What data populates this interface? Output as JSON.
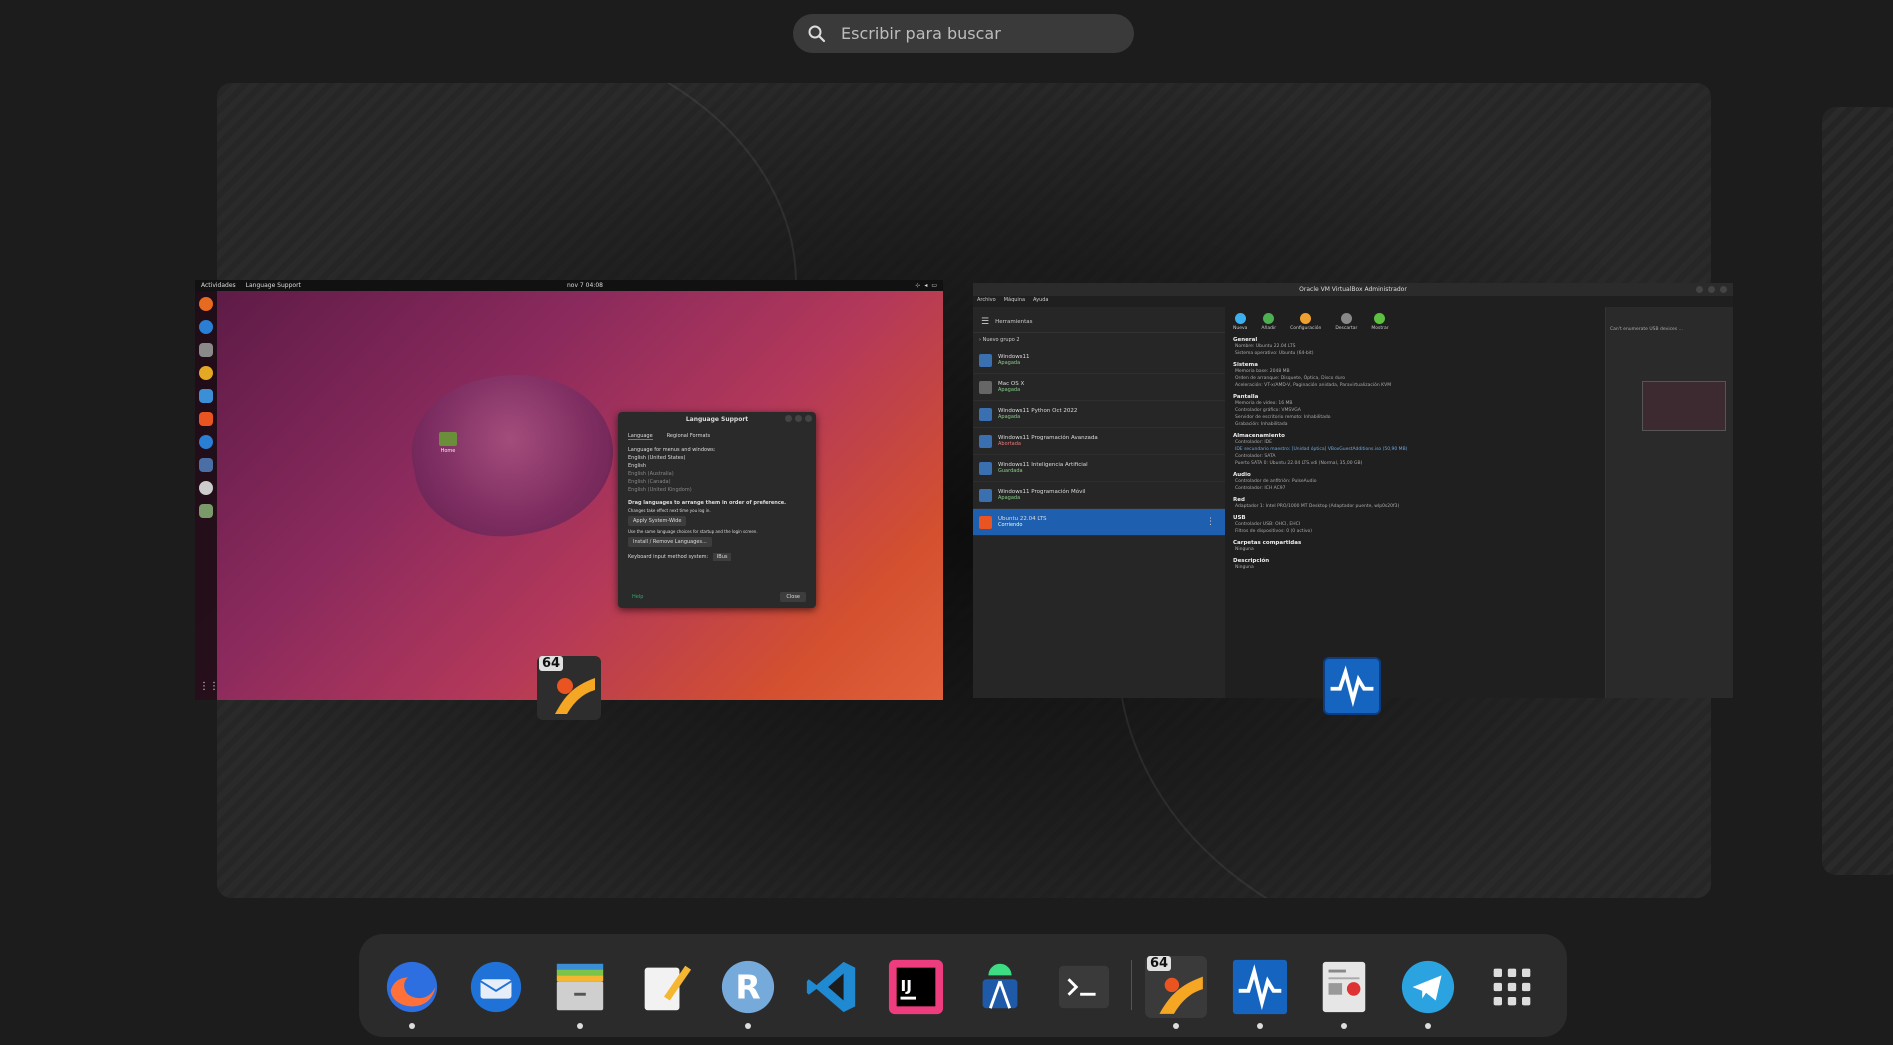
{
  "search": {
    "placeholder": "Escribir para buscar"
  },
  "ubuntu_window": {
    "topbar": {
      "activities": "Actividades",
      "app": "Language Support",
      "clock": "nov 7  04:08"
    },
    "desktop_icon_label": "Home",
    "dialog": {
      "title": "Language Support",
      "tabs": [
        "Language",
        "Regional Formats"
      ],
      "heading": "Language for menus and windows:",
      "languages": [
        "English (United States)",
        "English",
        "English (Australia)",
        "English (Canada)",
        "English (United Kingdom)"
      ],
      "drag_hint": "Drag languages to arrange them in order of preference.",
      "drag_hint_sub": "Changes take effect next time you log in.",
      "apply_button": "Apply System-Wide",
      "same_hint": "Use the same language choices for startup and the login screen.",
      "install_button": "Install / Remove Languages...",
      "keyboard_label": "Keyboard input method system:",
      "keyboard_value": "IBus",
      "help": "Help",
      "close": "Close"
    }
  },
  "vbox_window": {
    "title": "Oracle VM VirtualBox Administrador",
    "menu": [
      "Archivo",
      "Máquina",
      "Ayuda"
    ],
    "tools_label": "Herramientas",
    "group_label": "Nuevo grupo 2",
    "vms": [
      {
        "name": "Windows11",
        "state": "Apagada"
      },
      {
        "name": "Mac OS X",
        "state": "Apagada"
      },
      {
        "name": "Windows11 Python Oct 2022",
        "state": "Apagada"
      },
      {
        "name": "Windows11 Programación Avanzada",
        "state": "Abortada"
      },
      {
        "name": "Windows11 Inteligencia Artificial",
        "state": "Guardada"
      },
      {
        "name": "Windows11 Programación Móvil",
        "state": "Apagada"
      },
      {
        "name": "Ubuntu 22.04 LTS",
        "state": "Corriendo"
      }
    ],
    "toolbar": [
      "Nueva",
      "Añadir",
      "Configuración",
      "Descartar",
      "Mostrar"
    ],
    "sections": [
      {
        "title": "General",
        "rows": [
          "Nombre:  Ubuntu 22.04 LTS",
          "Sistema operativo:  Ubuntu (64-bit)"
        ]
      },
      {
        "title": "Sistema",
        "rows": [
          "Memoria base:  2048 MB",
          "Orden de arranque:  Disquete, Óptica, Disco duro",
          "Aceleración:  VT-x/AMD-V, Paginación anidada, Paravirtualización KVM"
        ]
      },
      {
        "title": "Pantalla",
        "rows": [
          "Memoria de vídeo:  16 MB",
          "Controlador gráfico:  VMSVGA",
          "Servidor de escritorio remoto:  Inhabilitado",
          "Grabación:  Inhabilitada"
        ]
      },
      {
        "title": "Almacenamiento",
        "rows": [
          "Controlador: IDE",
          "IDE secundario maestro:  [Unidad óptica] VBoxGuestAdditions.iso (50,90 MB)",
          "Controlador: SATA",
          "Puerto SATA 0:  Ubuntu 22.04 LTS.vdi (Normal, 35,00 GB)"
        ]
      },
      {
        "title": "Audio",
        "rows": [
          "Controlador de anfitrión:  PulseAudio",
          "Controlador:  ICH AC97"
        ]
      },
      {
        "title": "Red",
        "rows": [
          "Adaptador 1:  Intel PRO/1000 MT Desktop (Adaptador puente, wlp0s20f3)"
        ]
      },
      {
        "title": "USB",
        "rows": [
          "Controlador USB:  OHCI, EHCI",
          "Filtros de dispositivos:  0 (0 activo)"
        ]
      },
      {
        "title": "Carpetas compartidas",
        "rows": [
          "Ninguna"
        ]
      },
      {
        "title": "Descripción",
        "rows": [
          "Ninguna"
        ]
      }
    ],
    "preview_notice": "Can't enumerate USB devices ..."
  },
  "overlay_badge": "64",
  "dock": {
    "apps": [
      {
        "name": "Firefox",
        "icon": "firefox-icon",
        "running": true
      },
      {
        "name": "Thunderbird",
        "icon": "thunderbird-icon",
        "running": false
      },
      {
        "name": "Files",
        "icon": "files-icon",
        "running": true
      },
      {
        "name": "Text Editor",
        "icon": "text-editor-icon",
        "running": false
      },
      {
        "name": "RStudio",
        "icon": "r-icon",
        "running": true
      },
      {
        "name": "Visual Studio Code",
        "icon": "vscode-icon",
        "running": false
      },
      {
        "name": "IntelliJ IDEA",
        "icon": "intellij-icon",
        "running": false
      },
      {
        "name": "Android Studio",
        "icon": "android-studio-icon",
        "running": false
      },
      {
        "name": "Terminal",
        "icon": "terminal-icon",
        "running": false
      },
      {
        "name": "VirtualBox",
        "icon": "virtualbox-icon",
        "running": true,
        "badge": "64"
      },
      {
        "name": "System Monitor",
        "icon": "system-monitor-icon",
        "running": true
      },
      {
        "name": "Document Viewer",
        "icon": "document-viewer-icon",
        "running": true
      },
      {
        "name": "Telegram",
        "icon": "telegram-icon",
        "running": true
      },
      {
        "name": "Show Applications",
        "icon": "app-grid-icon",
        "running": false
      }
    ]
  },
  "colors": {
    "ubuntu_orange": "#e95420",
    "vbox_selection": "#1f5fb0",
    "dock_bg": "#2b2b2b"
  }
}
